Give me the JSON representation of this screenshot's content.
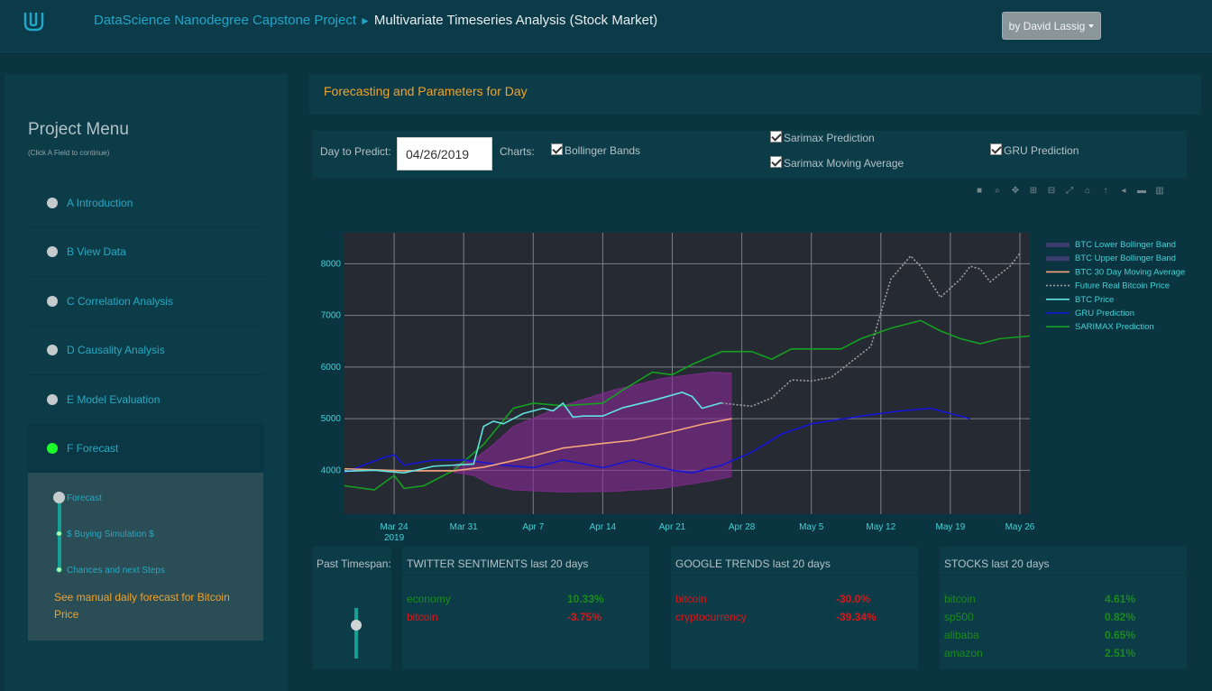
{
  "header": {
    "crumb_link": "DataScience Nanodegree Capstone Project",
    "crumb_sep": "►",
    "crumb_current": "Multivariate Timeseries Analysis (Stock Market)",
    "user_button": "by David Lassig"
  },
  "sidebar": {
    "title": "Project Menu",
    "subtitle": "(Click A Field to continue)",
    "items": [
      {
        "label": "A Introduction"
      },
      {
        "label": "B View Data"
      },
      {
        "label": "C Correlation Analysis"
      },
      {
        "label": "D Causality Analysis"
      },
      {
        "label": "E Model Evaluation"
      },
      {
        "label": "F Forecast"
      }
    ],
    "sub_items": [
      "Forecast",
      "$ Buying Simulation $",
      "Chances and next Steps"
    ],
    "sub_link": "See manual daily forecast for Bitcoin Price"
  },
  "main": {
    "title": "Forecasting and Parameters for Day",
    "day_label": "Day to Predict:",
    "date_value": "04/26/2019",
    "charts_label": "Charts:",
    "checks": {
      "bollinger": "Bollinger Bands",
      "sarimax": "Sarimax Prediction",
      "sarimax_ma": "Sarimax Moving Average",
      "gru": "GRU Prediction"
    }
  },
  "chart_data": {
    "type": "line",
    "x_ticks": [
      "Mar 24\n2019",
      "Mar 31",
      "Apr 7",
      "Apr 14",
      "Apr 21",
      "Apr 28",
      "May 5",
      "May 12",
      "May 19",
      "May 26"
    ],
    "y_ticks": [
      4000,
      5000,
      6000,
      7000,
      8000
    ],
    "ylim": [
      3150,
      8600
    ],
    "xlim": [
      "2019-03-19",
      "2019-05-27"
    ],
    "grid": true,
    "legend_position": "right",
    "series": [
      {
        "name": "BTC Lower Bollinger Band",
        "color": "#3c3c6e",
        "x": [
          "2019-03-30",
          "2019-04-01",
          "2019-04-03",
          "2019-04-05",
          "2019-04-10",
          "2019-04-15",
          "2019-04-20",
          "2019-04-25",
          "2019-04-27"
        ],
        "y": [
          3960,
          3900,
          3700,
          3620,
          3580,
          3590,
          3650,
          3800,
          3880
        ]
      },
      {
        "name": "BTC Upper Bollinger Band",
        "color": "#3c3c6e",
        "x": [
          "2019-03-30",
          "2019-04-01",
          "2019-04-03",
          "2019-04-05",
          "2019-04-10",
          "2019-04-15",
          "2019-04-20",
          "2019-04-25",
          "2019-04-27"
        ],
        "y": [
          4100,
          4200,
          4500,
          4850,
          5250,
          5550,
          5780,
          5900,
          5880
        ]
      },
      {
        "name": "BTC 30 Day Moving Average",
        "color": "#f4a57a",
        "x": [
          "2019-03-19",
          "2019-03-25",
          "2019-03-30",
          "2019-04-02",
          "2019-04-06",
          "2019-04-10",
          "2019-04-14",
          "2019-04-17",
          "2019-04-21",
          "2019-04-24",
          "2019-04-27"
        ],
        "y": [
          4030,
          3990,
          3990,
          4060,
          4230,
          4430,
          4520,
          4580,
          4750,
          4890,
          5000
        ],
        "dash": false
      },
      {
        "name": "Future Real Bitcoin Price",
        "color": "#a0a0a0",
        "dash": true,
        "x": [
          "2019-04-26",
          "2019-04-29",
          "2019-05-01",
          "2019-05-03",
          "2019-05-05",
          "2019-05-07",
          "2019-05-09",
          "2019-05-11",
          "2019-05-13",
          "2019-05-15",
          "2019-05-16",
          "2019-05-18",
          "2019-05-20",
          "2019-05-21",
          "2019-05-22",
          "2019-05-23",
          "2019-05-25",
          "2019-05-26"
        ],
        "y": [
          5300,
          5240,
          5400,
          5750,
          5730,
          5800,
          6100,
          6400,
          7700,
          8150,
          7950,
          7350,
          7700,
          7950,
          7900,
          7650,
          7950,
          8200
        ]
      },
      {
        "name": "BTC Price",
        "color": "#5fe3e0",
        "x": [
          "2019-03-19",
          "2019-03-22",
          "2019-03-25",
          "2019-03-28",
          "2019-03-30",
          "2019-04-01",
          "2019-04-02",
          "2019-04-03",
          "2019-04-04",
          "2019-04-06",
          "2019-04-08",
          "2019-04-09",
          "2019-04-10",
          "2019-04-11",
          "2019-04-12",
          "2019-04-14",
          "2019-04-16",
          "2019-04-19",
          "2019-04-22",
          "2019-04-23",
          "2019-04-24",
          "2019-04-26"
        ],
        "y": [
          3980,
          4000,
          3950,
          4080,
          4100,
          4120,
          4850,
          4950,
          4900,
          5100,
          5200,
          5150,
          5300,
          5030,
          5050,
          5050,
          5210,
          5350,
          5510,
          5430,
          5200,
          5310
        ]
      },
      {
        "name": "GRU Prediction",
        "color": "#1515d8",
        "x": [
          "2019-03-19",
          "2019-03-23",
          "2019-03-24",
          "2019-03-25",
          "2019-03-28",
          "2019-03-31",
          "2019-04-04",
          "2019-04-07",
          "2019-04-10",
          "2019-04-14",
          "2019-04-17",
          "2019-04-21",
          "2019-04-23",
          "2019-04-26",
          "2019-04-29",
          "2019-05-02",
          "2019-05-05",
          "2019-05-10",
          "2019-05-14",
          "2019-05-17",
          "2019-05-21"
        ],
        "y": [
          3960,
          4250,
          4300,
          4100,
          4200,
          4200,
          4100,
          4050,
          4200,
          4050,
          4200,
          4000,
          3950,
          4100,
          4350,
          4700,
          4900,
          5050,
          5150,
          5200,
          5000
        ]
      },
      {
        "name": "SARIMAX Prediction",
        "color": "#14a020",
        "x": [
          "2019-03-19",
          "2019-03-22",
          "2019-03-24",
          "2019-03-25",
          "2019-03-27",
          "2019-03-30",
          "2019-04-02",
          "2019-04-05",
          "2019-04-07",
          "2019-04-10",
          "2019-04-14",
          "2019-04-16",
          "2019-04-19",
          "2019-04-21",
          "2019-04-23",
          "2019-04-26",
          "2019-04-29",
          "2019-05-01",
          "2019-05-03",
          "2019-05-05",
          "2019-05-08",
          "2019-05-10",
          "2019-05-13",
          "2019-05-16",
          "2019-05-18",
          "2019-05-20",
          "2019-05-22",
          "2019-05-24",
          "2019-05-27"
        ],
        "y": [
          3700,
          3620,
          3900,
          3650,
          3700,
          4000,
          4500,
          5200,
          5300,
          5250,
          5300,
          5550,
          5900,
          5850,
          6050,
          6300,
          6300,
          6150,
          6350,
          6350,
          6350,
          6550,
          6750,
          6900,
          6700,
          6550,
          6450,
          6550,
          6600
        ]
      }
    ]
  },
  "panels": {
    "past_timespan": "Past Timespan:",
    "twitter": {
      "title": "TWITTER SENTIMENTS last 20 days",
      "rows": [
        {
          "k": "economy",
          "v": "10.33%",
          "s": "pos"
        },
        {
          "k": "bitcoin",
          "v": "-3.75%",
          "s": "neg"
        }
      ]
    },
    "google": {
      "title": "GOOGLE TRENDS last 20 days",
      "rows": [
        {
          "k": "bitcoin",
          "v": "-30.0%",
          "s": "neg"
        },
        {
          "k": "cryptocurrency",
          "v": "-39.34%",
          "s": "neg"
        }
      ]
    },
    "stocks": {
      "title": "STOCKS last 20 days",
      "rows": [
        {
          "k": "bitcoin",
          "v": "4.61%",
          "s": "pos"
        },
        {
          "k": "sp500",
          "v": "0.82%",
          "s": "pos"
        },
        {
          "k": "alibaba",
          "v": "0.65%",
          "s": "pos"
        },
        {
          "k": "amazon",
          "v": "2.51%",
          "s": "pos"
        }
      ]
    }
  },
  "colors": {
    "accent": "#f0a32c",
    "link": "#1fa6c9",
    "pos": "#1c8a1e",
    "neg": "#d81818"
  }
}
